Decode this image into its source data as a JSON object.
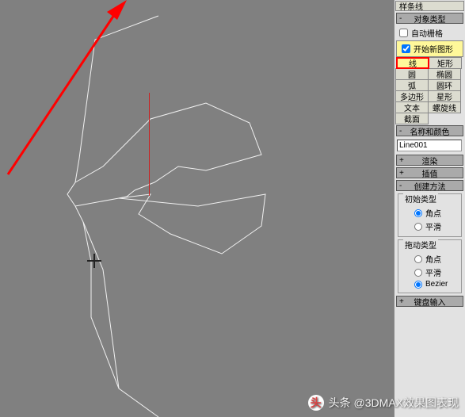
{
  "panel_top": "样条线",
  "rollout_object_type": "对象类型",
  "auto_grid": "自动栅格",
  "start_new_shape": "开始新图形",
  "shapes": {
    "r1c1": "线",
    "r1c2": "矩形",
    "r2c1": "圆",
    "r2c2": "椭圆",
    "r3c1": "弧",
    "r3c2": "圆环",
    "r4c1": "多边形",
    "r4c2": "星形",
    "r5c1": "文本",
    "r5c2": "螺旋线",
    "r6c1": "截面",
    "r6c2": ""
  },
  "rollout_name_color": "名称和颜色",
  "object_name": "Line001",
  "rollout_render": "渲染",
  "rollout_interp": "插值",
  "rollout_create_method": "创建方法",
  "initial_type": "初始类型",
  "drag_type": "拖动类型",
  "opt_corner": "角点",
  "opt_smooth": "平滑",
  "opt_bezier": "Bezier",
  "rollout_keyboard": "键盘输入",
  "watermark": "头条 @3DMAX效果图表现"
}
